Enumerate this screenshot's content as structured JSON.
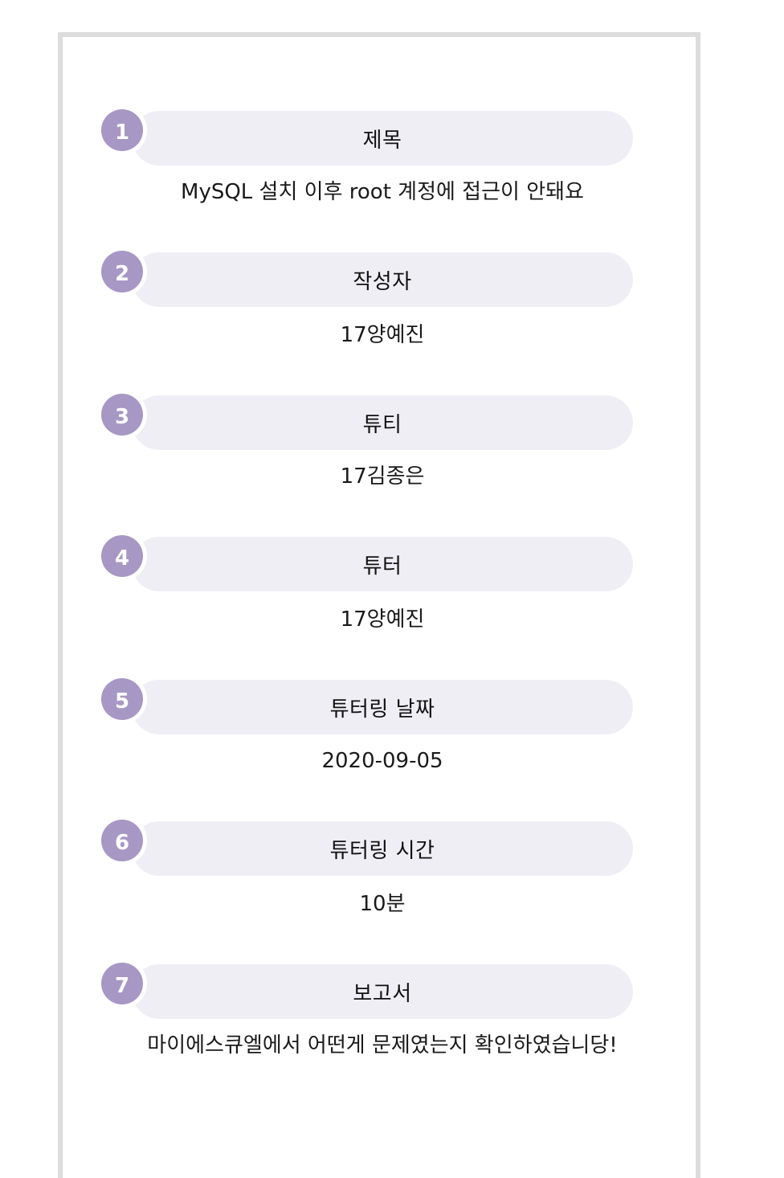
{
  "fields": [
    {
      "number": "1",
      "label": "제목",
      "value": "MySQL 설치 이후 root 계정에 접근이 안돼요"
    },
    {
      "number": "2",
      "label": "작성자",
      "value": "17양예진"
    },
    {
      "number": "3",
      "label": "튜티",
      "value": "17김종은"
    },
    {
      "number": "4",
      "label": "튜터",
      "value": "17양예진"
    },
    {
      "number": "5",
      "label": "튜터링 날짜",
      "value": "2020-09-05"
    },
    {
      "number": "6",
      "label": "튜터링 시간",
      "value": "10분"
    },
    {
      "number": "7",
      "label": "보고서",
      "value": "마이에스큐엘에서 어떤게 문제였는지 확인하였습니당!"
    }
  ],
  "colors": {
    "badge": "#a797c4",
    "pill": "#f0eef5",
    "card_border": "#dcdcdc"
  }
}
